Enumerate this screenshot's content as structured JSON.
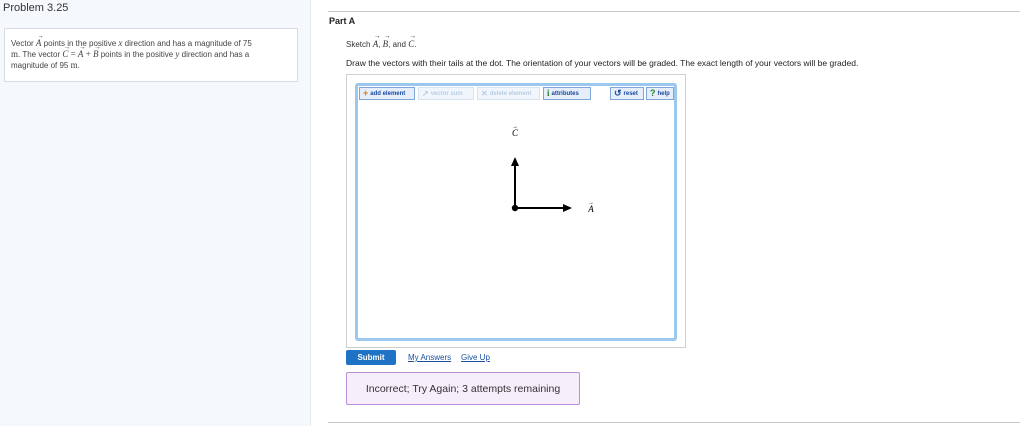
{
  "left": {
    "problem_title": "Problem 3.25",
    "text": {
      "vector": "Vector",
      "A": "A",
      "points_pos_x": "points in the positive",
      "x": "x",
      "dir_mag": "direction and has a magnitude of 75",
      "m1": "m",
      "the_vector": ". The vector",
      "C": "C",
      "eq": "=",
      "A2": "A",
      "plus": "+",
      "B": "B",
      "points_pos_y": "points in the positive",
      "y": "y",
      "dir_has": "direction and has a",
      "mag95": "magnitude of 95",
      "m2": "m",
      "period": "."
    }
  },
  "part": {
    "title": "Part A",
    "sketch": {
      "prefix": "Sketch",
      "A": "A",
      "c1": ",",
      "B": "B",
      "c2": ", and",
      "C": "C",
      "end": "."
    },
    "instruction": "Draw the vectors with their tails at the dot. The orientation of your vectors will be graded. The exact length of your vectors will be graded."
  },
  "toolbar": {
    "add_element": "add element",
    "vector_sum": "vector sum",
    "delete_element": "delete element",
    "attributes": "attributes",
    "reset": "reset",
    "help": "help"
  },
  "canvas": {
    "label_c": "C",
    "label_a": "A"
  },
  "actions": {
    "submit": "Submit",
    "my_answers": "My Answers",
    "give_up": "Give Up"
  },
  "feedback": "Incorrect; Try Again; 3 attempts remaining",
  "colors": {
    "accent": "#1f73c4",
    "canvas_border": "#9cc7ef",
    "feedback_bg": "#f7eefc",
    "feedback_border": "#b98fd8",
    "add_icon": "#e07a00",
    "attr_icon": "#2e7d32",
    "help_icon": "#2e7d32"
  },
  "icons": {
    "add": "plus-icon",
    "vector_sum": "vector-sum-icon",
    "delete": "delete-x-icon",
    "attributes": "info-icon",
    "reset": "reset-arrow-icon",
    "help": "question-icon"
  }
}
